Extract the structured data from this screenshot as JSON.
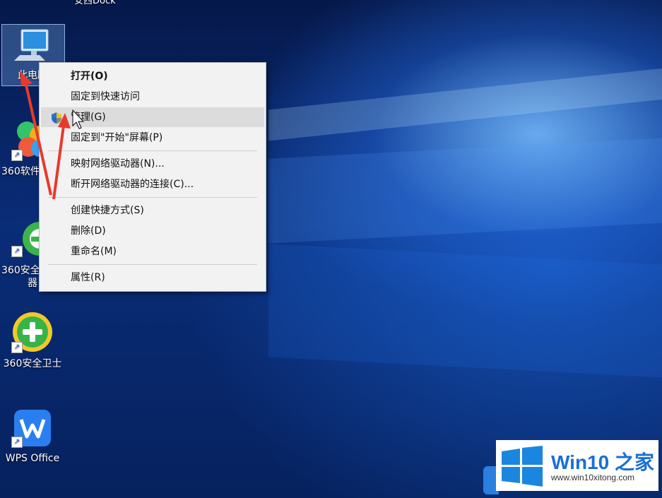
{
  "desktop": {
    "top_partial_label": "安西Dock",
    "icons": [
      {
        "label": "此电脑"
      },
      {
        "label": "360软件"
      },
      {
        "label_line1": "360安全",
        "label_line2": "器"
      },
      {
        "label": "360安全卫士"
      },
      {
        "label": "WPS Office"
      }
    ]
  },
  "context_menu": {
    "items": [
      {
        "label": "打开(O)"
      },
      {
        "label": "固定到快速访问"
      },
      {
        "label": "管理(G)"
      },
      {
        "label": "固定到\"开始\"屏幕(P)"
      },
      {
        "label": "映射网络驱动器(N)..."
      },
      {
        "label": "断开网络驱动器的连接(C)..."
      },
      {
        "label": "创建快捷方式(S)"
      },
      {
        "label": "删除(D)"
      },
      {
        "label": "重命名(M)"
      },
      {
        "label": "属性(R)"
      }
    ]
  },
  "watermark": {
    "brand": "Win10 之家",
    "url": "www.win10xitong.com",
    "colors": {
      "brand": "#1a6fd6",
      "logo": "#1a86e0"
    }
  },
  "icons": {
    "computer": "monitor-icon",
    "uac": "shield-icon",
    "shortcut": "shortcut-arrow-icon"
  }
}
